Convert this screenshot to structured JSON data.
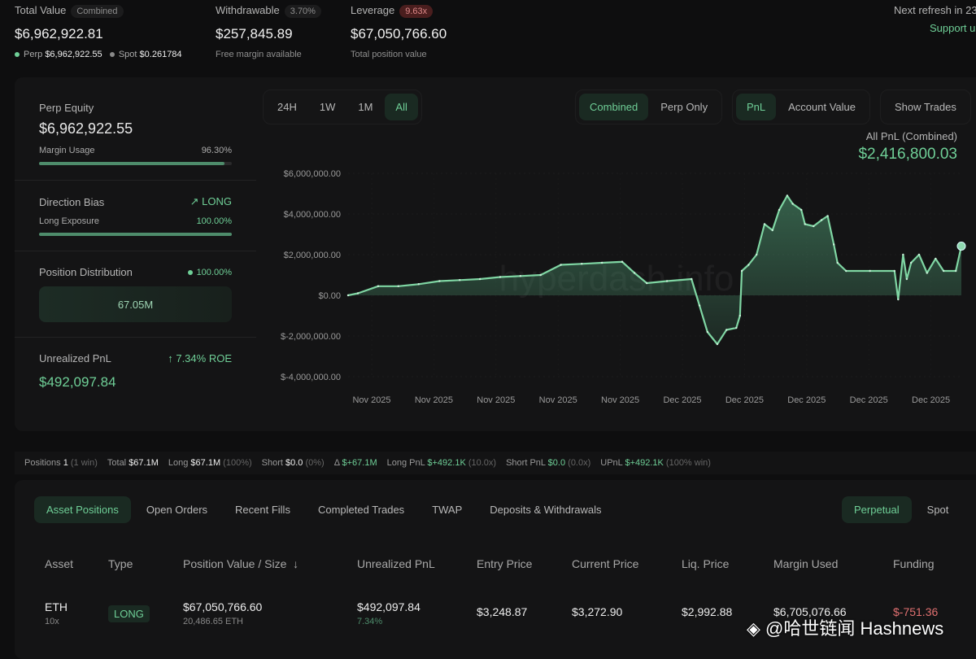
{
  "header": {
    "total_value": {
      "label": "Total Value",
      "badge": "Combined",
      "value": "$6,962,922.81",
      "perp_label": "Perp",
      "perp_value": "$6,962,922.55",
      "spot_label": "Spot",
      "spot_value": "$0.261784"
    },
    "withdrawable": {
      "label": "Withdrawable",
      "badge": "3.70%",
      "value": "$257,845.89",
      "sub": "Free margin available"
    },
    "leverage": {
      "label": "Leverage",
      "badge": "9.63x",
      "value": "$67,050,766.60",
      "sub": "Total position value"
    },
    "refresh": "Next refresh in 23",
    "support": "Support u"
  },
  "left": {
    "perp_equity_label": "Perp Equity",
    "perp_equity": "$6,962,922.55",
    "margin_usage_label": "Margin Usage",
    "margin_usage": "96.30%",
    "margin_usage_pct": 96.3,
    "direction_label": "Direction Bias",
    "direction": "LONG",
    "long_exposure_label": "Long Exposure",
    "long_exposure": "100.00%",
    "long_exposure_pct": 100,
    "distribution_label": "Position Distribution",
    "distribution": "100.00%",
    "distribution_value": "67.05M",
    "upnl_label": "Unrealized PnL",
    "roe": "7.34% ROE",
    "upnl": "$492,097.84"
  },
  "controls": {
    "ranges": [
      "24H",
      "1W",
      "1M",
      "All"
    ],
    "modes": [
      "Combined",
      "Perp Only"
    ],
    "metrics": [
      "PnL",
      "Account Value"
    ],
    "show_trades": "Show Trades"
  },
  "chart_data": {
    "type": "area",
    "title": "All PnL (Combined)",
    "headline": "$2,416,800.03",
    "watermark": "hyperdash.info",
    "ylim": [
      -4000000,
      6000000
    ],
    "yticks": [
      "$6,000,000.00",
      "$4,000,000.00",
      "$2,000,000.00",
      "$0.00",
      "$-2,000,000.00",
      "$-4,000,000.00"
    ],
    "ytick_values": [
      6000000,
      4000000,
      2000000,
      0,
      -2000000,
      -4000000
    ],
    "xticks": [
      "Nov 2025",
      "Nov 2025",
      "Nov 2025",
      "Nov 2025",
      "Nov 2025",
      "Dec 2025",
      "Dec 2025",
      "Dec 2025",
      "Dec 2025",
      "Dec 2025"
    ],
    "xlabel": "",
    "ylabel": "",
    "points": [
      [
        0,
        0
      ],
      [
        1.6,
        0.1
      ],
      [
        4.9,
        0.45
      ],
      [
        8.2,
        0.45
      ],
      [
        11.5,
        0.55
      ],
      [
        14.9,
        0.7
      ],
      [
        18.2,
        0.75
      ],
      [
        21.5,
        0.8
      ],
      [
        24.8,
        0.9
      ],
      [
        28.1,
        0.95
      ],
      [
        31.4,
        1.0
      ],
      [
        34.7,
        1.5
      ],
      [
        38.1,
        1.55
      ],
      [
        41.4,
        1.6
      ],
      [
        44.7,
        1.65
      ],
      [
        46.7,
        1.1
      ],
      [
        48.7,
        0.6
      ],
      [
        52,
        0.7
      ],
      [
        56,
        0.8
      ],
      [
        57.3,
        -0.5
      ],
      [
        58.6,
        -1.8
      ],
      [
        60.2,
        -2.4
      ],
      [
        61.7,
        -1.7
      ],
      [
        63.3,
        -1.6
      ],
      [
        63.9,
        -1.0
      ],
      [
        64.2,
        1.2
      ],
      [
        65.3,
        1.5
      ],
      [
        66.6,
        2.0
      ],
      [
        67.9,
        3.5
      ],
      [
        69.2,
        3.2
      ],
      [
        70.3,
        4.2
      ],
      [
        71.6,
        4.9
      ],
      [
        72.5,
        4.5
      ],
      [
        73.9,
        4.2
      ],
      [
        74.5,
        3.5
      ],
      [
        75.9,
        3.4
      ],
      [
        77.2,
        3.7
      ],
      [
        78.2,
        3.9
      ],
      [
        79.2,
        2.5
      ],
      [
        79.8,
        1.6
      ],
      [
        81.2,
        1.2
      ],
      [
        85.1,
        1.2
      ],
      [
        89.1,
        1.2
      ],
      [
        89.7,
        -0.2
      ],
      [
        90.5,
        2.0
      ],
      [
        91.1,
        0.8
      ],
      [
        91.8,
        1.6
      ],
      [
        93.1,
        2.0
      ],
      [
        94.4,
        1.1
      ],
      [
        95.8,
        1.8
      ],
      [
        97.1,
        1.2
      ],
      [
        99.1,
        1.2
      ],
      [
        100,
        2.42
      ]
    ],
    "points_units": "[time % of range, value in $M]"
  },
  "stats": [
    {
      "k": "Positions",
      "v": "1",
      "x": "(1 win)"
    },
    {
      "k": "Total",
      "v": "$67.1M",
      "x": ""
    },
    {
      "k": "Long",
      "v": "$67.1M",
      "x": "(100%)"
    },
    {
      "k": "Short",
      "v": "$0.0",
      "x": "(0%)"
    },
    {
      "k": "Δ",
      "v": "$+67.1M",
      "x": "",
      "g": true
    },
    {
      "k": "Long PnL",
      "v": "$+492.1K",
      "x": "(10.0x)",
      "g": true
    },
    {
      "k": "Short PnL",
      "v": "$0.0",
      "x": "(0.0x)",
      "g": true
    },
    {
      "k": "UPnL",
      "v": "$+492.1K",
      "x": "(100% win)",
      "g": true
    }
  ],
  "tabs": [
    "Asset Positions",
    "Open Orders",
    "Recent Fills",
    "Completed Trades",
    "TWAP",
    "Deposits & Withdrawals"
  ],
  "market_tabs": [
    "Perpetual",
    "Spot"
  ],
  "table": {
    "headers": [
      "Asset",
      "Type",
      "Position Value / Size",
      "Unrealized PnL",
      "Entry Price",
      "Current Price",
      "Liq. Price",
      "Margin Used",
      "Funding"
    ],
    "sort_icon": "↓",
    "row": {
      "asset": "ETH",
      "lev": "10x",
      "type": "LONG",
      "value": "$67,050,766.60",
      "size": "20,486.65 ETH",
      "upnl": "$492,097.84",
      "upnl_pct": "7.34%",
      "entry": "$3,248.87",
      "current": "$3,272.90",
      "liq": "$2,992.88",
      "margin": "$6,705,076.66",
      "funding": "$-751.36"
    }
  },
  "watermark_text": "@哈世链闻 Hashnews",
  "colors": {
    "accent": "#6fcf97",
    "negative": "#e07070",
    "bg": "#0e0e0f"
  }
}
